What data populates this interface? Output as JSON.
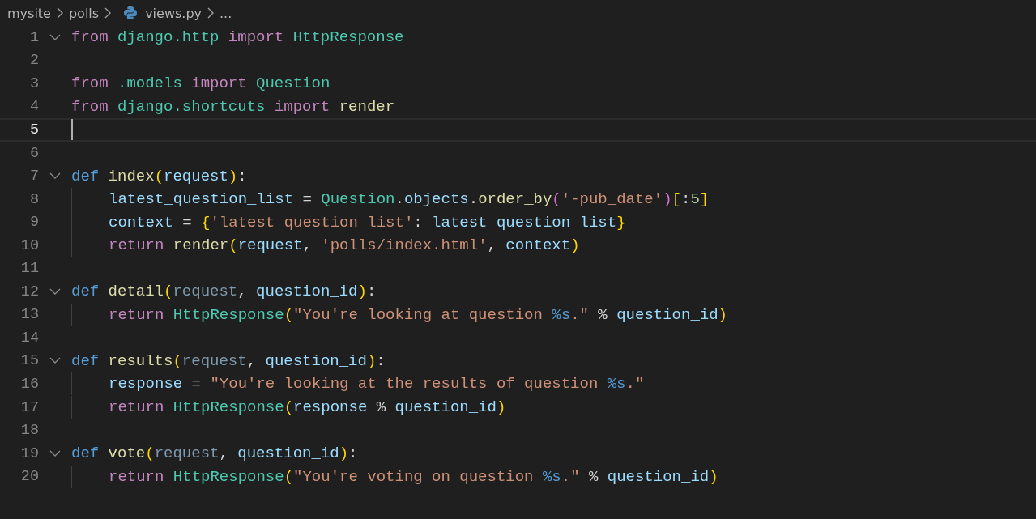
{
  "breadcrumb": [
    {
      "label": "mysite",
      "kind": "folder"
    },
    {
      "label": "polls",
      "kind": "folder"
    },
    {
      "label": "views.py",
      "kind": "python-file"
    },
    {
      "label": "...",
      "kind": "more"
    }
  ],
  "lines": [
    {
      "number": "1",
      "foldable": true,
      "current": false,
      "indented": false,
      "tokens": [
        {
          "text": "from ",
          "kind": "keyword"
        },
        {
          "text": "django.http",
          "kind": "module"
        },
        {
          "text": " import ",
          "kind": "keyword"
        },
        {
          "text": "HttpResponse",
          "kind": "class"
        }
      ]
    },
    {
      "number": "2",
      "foldable": false,
      "current": false,
      "indented": false
    },
    {
      "number": "3",
      "foldable": false,
      "current": false,
      "indented": false,
      "tokens": [
        {
          "text": "from ",
          "kind": "keyword"
        },
        {
          "text": ".models",
          "kind": "module"
        },
        {
          "text": " import ",
          "kind": "keyword"
        },
        {
          "text": "Question",
          "kind": "class"
        }
      ]
    },
    {
      "number": "4",
      "foldable": false,
      "current": false,
      "indented": false,
      "tokens": [
        {
          "text": "from ",
          "kind": "keyword"
        },
        {
          "text": "django.shortcuts",
          "kind": "module"
        },
        {
          "text": " import ",
          "kind": "keyword"
        },
        {
          "text": "render",
          "kind": "function"
        }
      ]
    },
    {
      "number": "5",
      "foldable": false,
      "current": true,
      "indented": false
    },
    {
      "number": "6",
      "foldable": false,
      "current": false,
      "indented": false
    },
    {
      "number": "7",
      "foldable": true,
      "current": false,
      "indented": false,
      "tokens": [
        {
          "text": "def ",
          "kind": "storage"
        },
        {
          "text": "index",
          "kind": "function"
        },
        {
          "text": "(",
          "kind": "bracket"
        },
        {
          "text": "request",
          "kind": "variable"
        },
        {
          "text": ")",
          "kind": "bracket"
        },
        {
          "text": ":",
          "kind": "plain"
        }
      ]
    },
    {
      "number": "8",
      "foldable": false,
      "current": false,
      "indented": true,
      "tokens": [
        {
          "text": "latest_question_list",
          "kind": "variable"
        },
        {
          "text": " = ",
          "kind": "plain"
        },
        {
          "text": "Question",
          "kind": "class"
        },
        {
          "text": ".",
          "kind": "plain"
        },
        {
          "text": "objects",
          "kind": "variable"
        },
        {
          "text": ".",
          "kind": "plain"
        },
        {
          "text": "order_by",
          "kind": "function"
        },
        {
          "text": "(",
          "kind": "bracket2"
        },
        {
          "text": "'-pub_date'",
          "kind": "string"
        },
        {
          "text": ")",
          "kind": "bracket2"
        },
        {
          "text": "[",
          "kind": "bracket"
        },
        {
          "text": ":",
          "kind": "plain"
        },
        {
          "text": "5",
          "kind": "number"
        },
        {
          "text": "]",
          "kind": "bracket"
        }
      ]
    },
    {
      "number": "9",
      "foldable": false,
      "current": false,
      "indented": true,
      "tokens": [
        {
          "text": "context",
          "kind": "variable"
        },
        {
          "text": " = ",
          "kind": "plain"
        },
        {
          "text": "{",
          "kind": "bracket"
        },
        {
          "text": "'latest_question_list'",
          "kind": "string"
        },
        {
          "text": ": ",
          "kind": "plain"
        },
        {
          "text": "latest_question_list",
          "kind": "variable"
        },
        {
          "text": "}",
          "kind": "bracket"
        }
      ]
    },
    {
      "number": "10",
      "foldable": false,
      "current": false,
      "indented": true,
      "tokens": [
        {
          "text": "return ",
          "kind": "keyword"
        },
        {
          "text": "render",
          "kind": "function"
        },
        {
          "text": "(",
          "kind": "bracket"
        },
        {
          "text": "request",
          "kind": "variable"
        },
        {
          "text": ", ",
          "kind": "plain"
        },
        {
          "text": "'polls/index.html'",
          "kind": "string"
        },
        {
          "text": ", ",
          "kind": "plain"
        },
        {
          "text": "context",
          "kind": "variable"
        },
        {
          "text": ")",
          "kind": "bracket"
        }
      ]
    },
    {
      "number": "11",
      "foldable": false,
      "current": false,
      "indented": false
    },
    {
      "number": "12",
      "foldable": true,
      "current": false,
      "indented": false,
      "tokens": [
        {
          "text": "def ",
          "kind": "storage"
        },
        {
          "text": "detail",
          "kind": "function"
        },
        {
          "text": "(",
          "kind": "bracket"
        },
        {
          "text": "request",
          "kind": "unused"
        },
        {
          "text": ", ",
          "kind": "plain"
        },
        {
          "text": "question_id",
          "kind": "variable"
        },
        {
          "text": ")",
          "kind": "bracket"
        },
        {
          "text": ":",
          "kind": "plain"
        }
      ]
    },
    {
      "number": "13",
      "foldable": false,
      "current": false,
      "indented": true,
      "tokens": [
        {
          "text": "return ",
          "kind": "keyword"
        },
        {
          "text": "HttpResponse",
          "kind": "class"
        },
        {
          "text": "(",
          "kind": "bracket"
        },
        {
          "text": "\"You're looking at question ",
          "kind": "string"
        },
        {
          "text": "%s",
          "kind": "format"
        },
        {
          "text": ".\"",
          "kind": "string"
        },
        {
          "text": " % ",
          "kind": "plain"
        },
        {
          "text": "question_id",
          "kind": "variable"
        },
        {
          "text": ")",
          "kind": "bracket"
        }
      ]
    },
    {
      "number": "14",
      "foldable": false,
      "current": false,
      "indented": false
    },
    {
      "number": "15",
      "foldable": true,
      "current": false,
      "indented": false,
      "tokens": [
        {
          "text": "def ",
          "kind": "storage"
        },
        {
          "text": "results",
          "kind": "function"
        },
        {
          "text": "(",
          "kind": "bracket"
        },
        {
          "text": "request",
          "kind": "unused"
        },
        {
          "text": ", ",
          "kind": "plain"
        },
        {
          "text": "question_id",
          "kind": "variable"
        },
        {
          "text": ")",
          "kind": "bracket"
        },
        {
          "text": ":",
          "kind": "plain"
        }
      ]
    },
    {
      "number": "16",
      "foldable": false,
      "current": false,
      "indented": true,
      "tokens": [
        {
          "text": "response",
          "kind": "variable"
        },
        {
          "text": " = ",
          "kind": "plain"
        },
        {
          "text": "\"You're looking at the results of question ",
          "kind": "string"
        },
        {
          "text": "%s",
          "kind": "format"
        },
        {
          "text": ".\"",
          "kind": "string"
        }
      ]
    },
    {
      "number": "17",
      "foldable": false,
      "current": false,
      "indented": true,
      "tokens": [
        {
          "text": "return ",
          "kind": "keyword"
        },
        {
          "text": "HttpResponse",
          "kind": "class"
        },
        {
          "text": "(",
          "kind": "bracket"
        },
        {
          "text": "response",
          "kind": "variable"
        },
        {
          "text": " % ",
          "kind": "plain"
        },
        {
          "text": "question_id",
          "kind": "variable"
        },
        {
          "text": ")",
          "kind": "bracket"
        }
      ]
    },
    {
      "number": "18",
      "foldable": false,
      "current": false,
      "indented": false
    },
    {
      "number": "19",
      "foldable": true,
      "current": false,
      "indented": false,
      "tokens": [
        {
          "text": "def ",
          "kind": "storage"
        },
        {
          "text": "vote",
          "kind": "function"
        },
        {
          "text": "(",
          "kind": "bracket"
        },
        {
          "text": "request",
          "kind": "unused"
        },
        {
          "text": ", ",
          "kind": "plain"
        },
        {
          "text": "question_id",
          "kind": "variable"
        },
        {
          "text": ")",
          "kind": "bracket"
        },
        {
          "text": ":",
          "kind": "plain"
        }
      ]
    },
    {
      "number": "20",
      "foldable": false,
      "current": false,
      "indented": true,
      "tokens": [
        {
          "text": "return ",
          "kind": "keyword"
        },
        {
          "text": "HttpResponse",
          "kind": "class"
        },
        {
          "text": "(",
          "kind": "bracket"
        },
        {
          "text": "\"You're voting on question ",
          "kind": "string"
        },
        {
          "text": "%s",
          "kind": "format"
        },
        {
          "text": ".\"",
          "kind": "string"
        },
        {
          "text": " % ",
          "kind": "plain"
        },
        {
          "text": "question_id",
          "kind": "variable"
        },
        {
          "text": ")",
          "kind": "bracket"
        }
      ]
    }
  ]
}
